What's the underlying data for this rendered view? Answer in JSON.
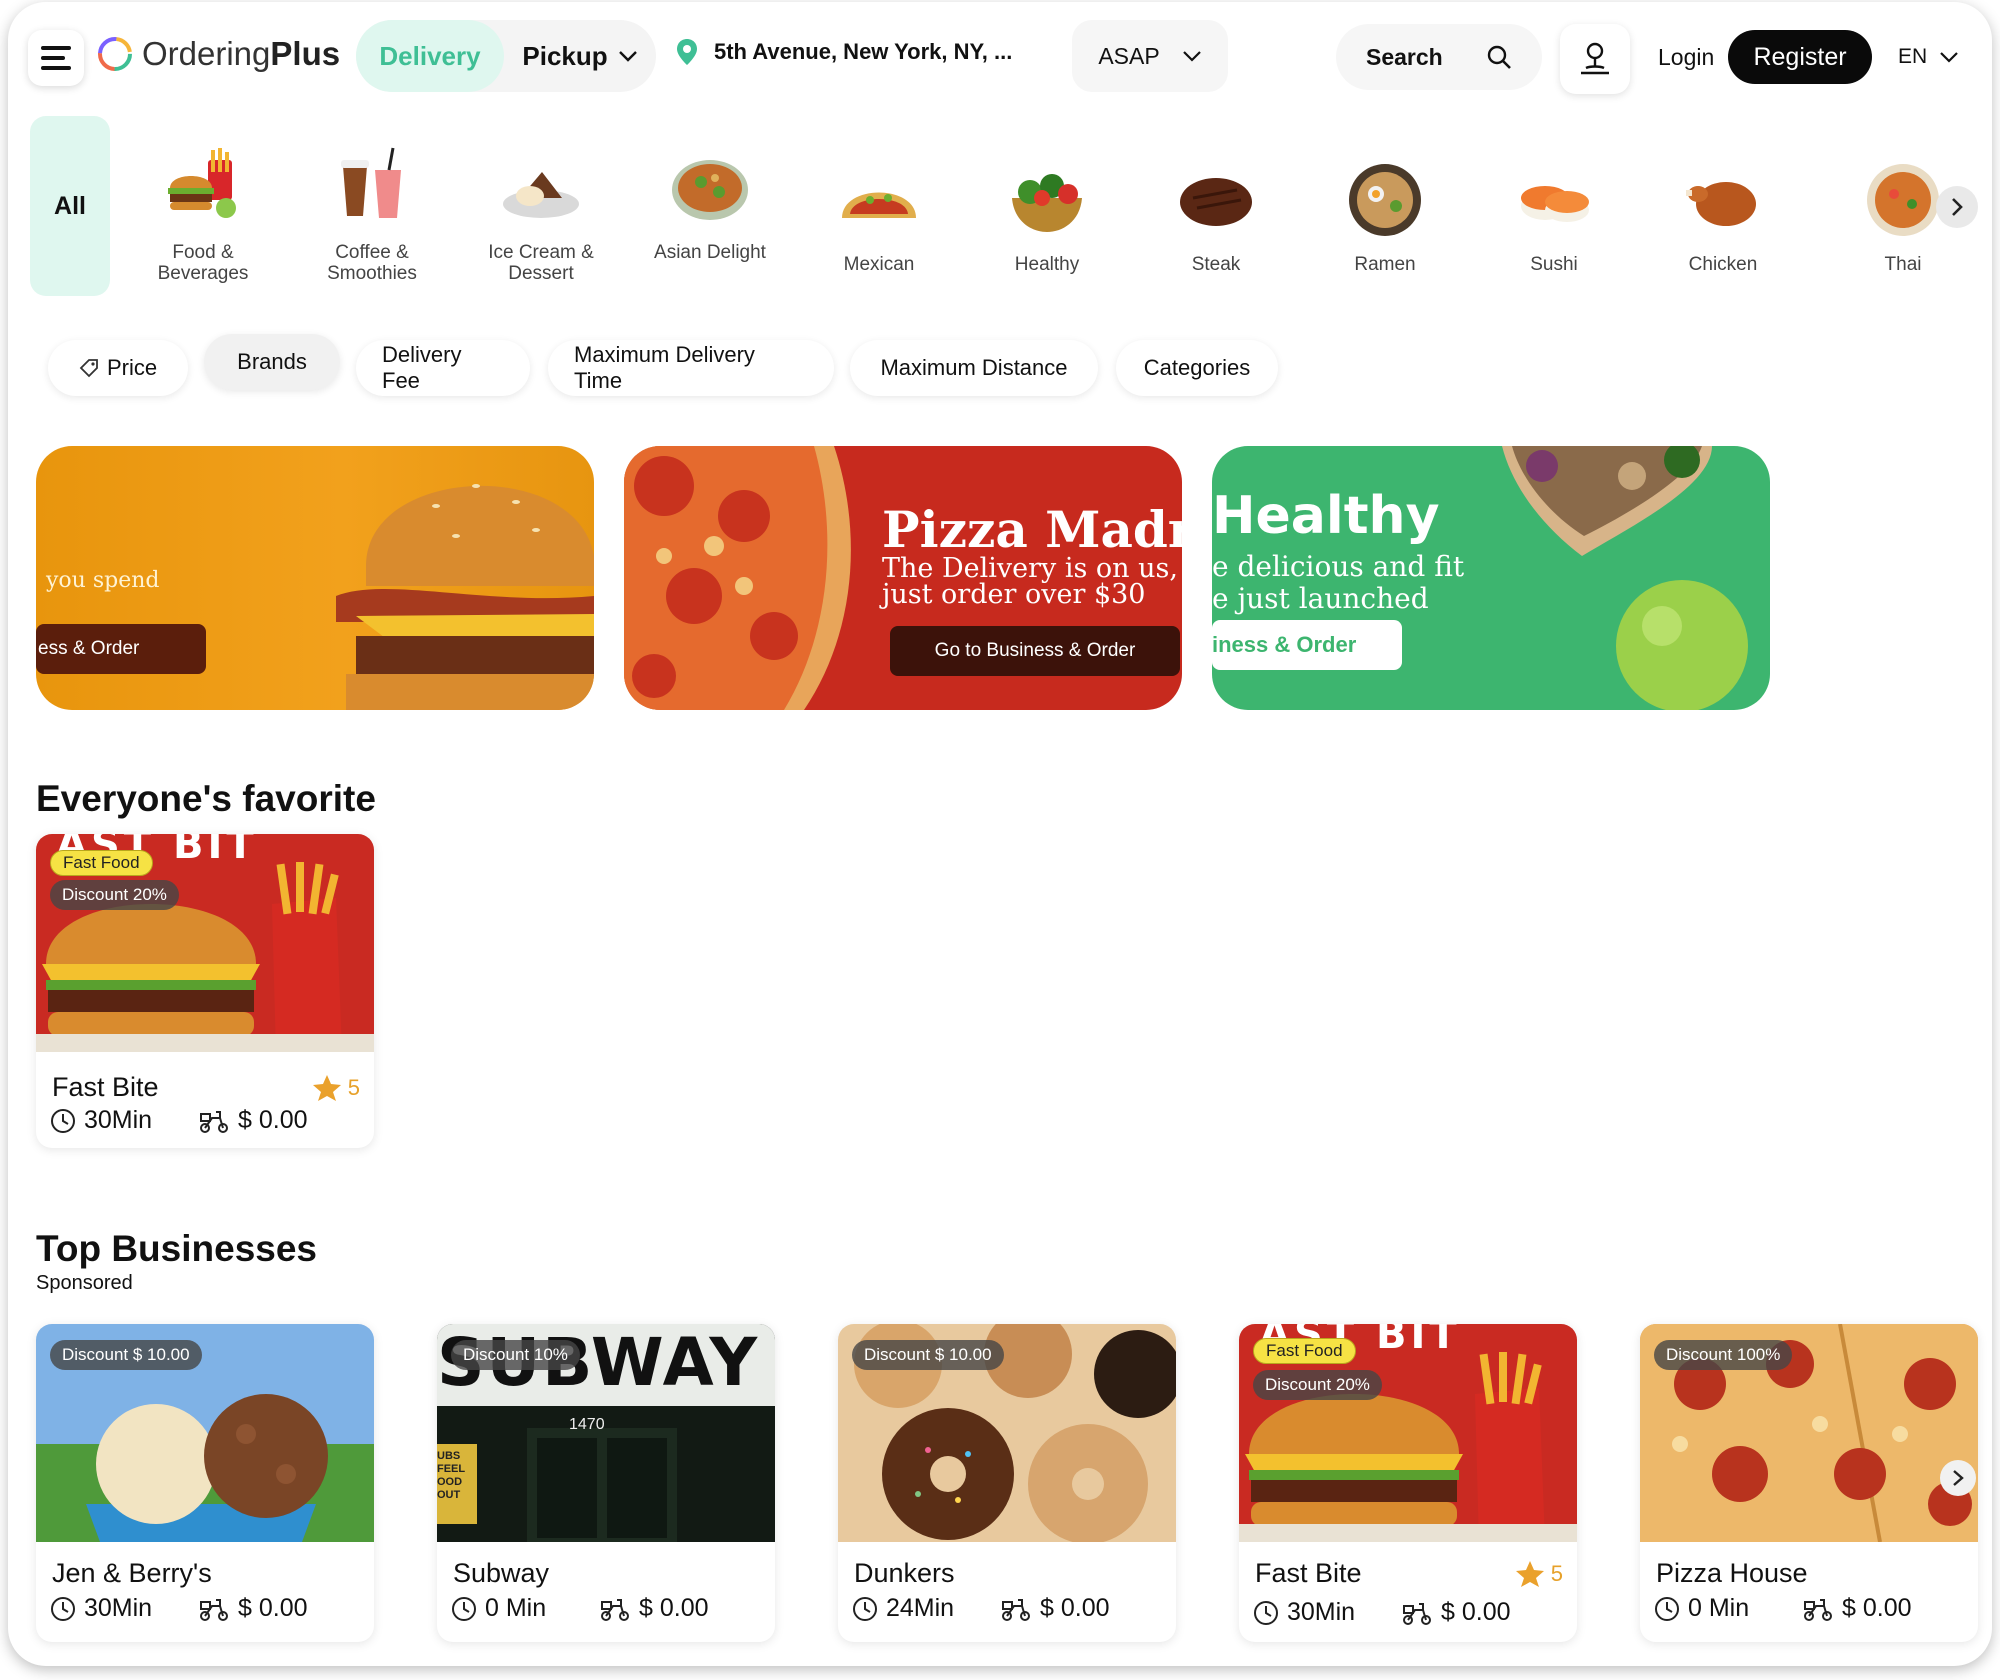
{
  "header": {
    "logo_text_light": "Ordering",
    "logo_text_bold": "Plus",
    "delivery_label": "Delivery",
    "pickup_label": "Pickup",
    "address": "5th Avenue, New York, NY, ...",
    "time_label": "ASAP",
    "search_label": "Search",
    "login_label": "Login",
    "register_label": "Register",
    "language": "EN",
    "accent_color": "#3fbf95"
  },
  "categories": {
    "all_label": "All",
    "items": [
      {
        "label": "Food & Beverages",
        "icon": "burger-fries-icon"
      },
      {
        "label": "Coffee & Smoothies",
        "icon": "drinks-icon"
      },
      {
        "label": "Ice Cream & Dessert",
        "icon": "dessert-icon"
      },
      {
        "label": "Asian Delight",
        "icon": "asian-bowl-icon"
      },
      {
        "label": "Mexican",
        "icon": "taco-icon"
      },
      {
        "label": "Healthy",
        "icon": "salad-icon"
      },
      {
        "label": "Steak",
        "icon": "steak-icon"
      },
      {
        "label": "Ramen",
        "icon": "ramen-icon"
      },
      {
        "label": "Sushi",
        "icon": "sushi-icon"
      },
      {
        "label": "Chicken",
        "icon": "chicken-icon"
      },
      {
        "label": "Thai",
        "icon": "thai-icon"
      }
    ]
  },
  "filters": [
    "Price",
    "Brands",
    "Delivery Fee",
    "Maximum Delivery Time",
    "Maximum Distance",
    "Categories"
  ],
  "banners": [
    {
      "line1": "you spend",
      "button": "ess & Order"
    },
    {
      "title": "Pizza Madr",
      "line1": "The Delivery is on us,",
      "line2": "just order over $30",
      "button": "Go to Business & Order"
    },
    {
      "title": "Healthy",
      "line1": "e delicious and fit",
      "line2": "e just launched",
      "button": "iness & Order"
    }
  ],
  "favorites": {
    "title": "Everyone's favorite",
    "cards": [
      {
        "name": "Fast Bite",
        "tag": "Fast Food",
        "discount": "Discount 20%",
        "time": "30Min",
        "fee": "$ 0.00",
        "rating": "5",
        "photo_text": "AST BIT"
      }
    ]
  },
  "top": {
    "title": "Top Businesses",
    "subtitle": "Sponsored",
    "cards": [
      {
        "name": "Jen & Berry's",
        "discount": "Discount $ 10.00",
        "time": "30Min",
        "fee": "$ 0.00"
      },
      {
        "name": "Subway",
        "discount": "Discount 10%",
        "time": "0 Min",
        "fee": "$ 0.00",
        "photo_text": "SUBWAY",
        "photo_number": "1470",
        "photo_side": "UBS FEEL OOD OUT"
      },
      {
        "name": "Dunkers",
        "discount": "Discount $ 10.00",
        "time": "24Min",
        "fee": "$ 0.00"
      },
      {
        "name": "Fast Bite",
        "tag": "Fast Food",
        "discount": "Discount 20%",
        "time": "30Min",
        "fee": "$ 0.00",
        "rating": "5",
        "photo_text": "AST BIT"
      },
      {
        "name": "Pizza House",
        "discount": "Discount 100%",
        "time": "0 Min",
        "fee": "$ 0.00"
      }
    ]
  }
}
